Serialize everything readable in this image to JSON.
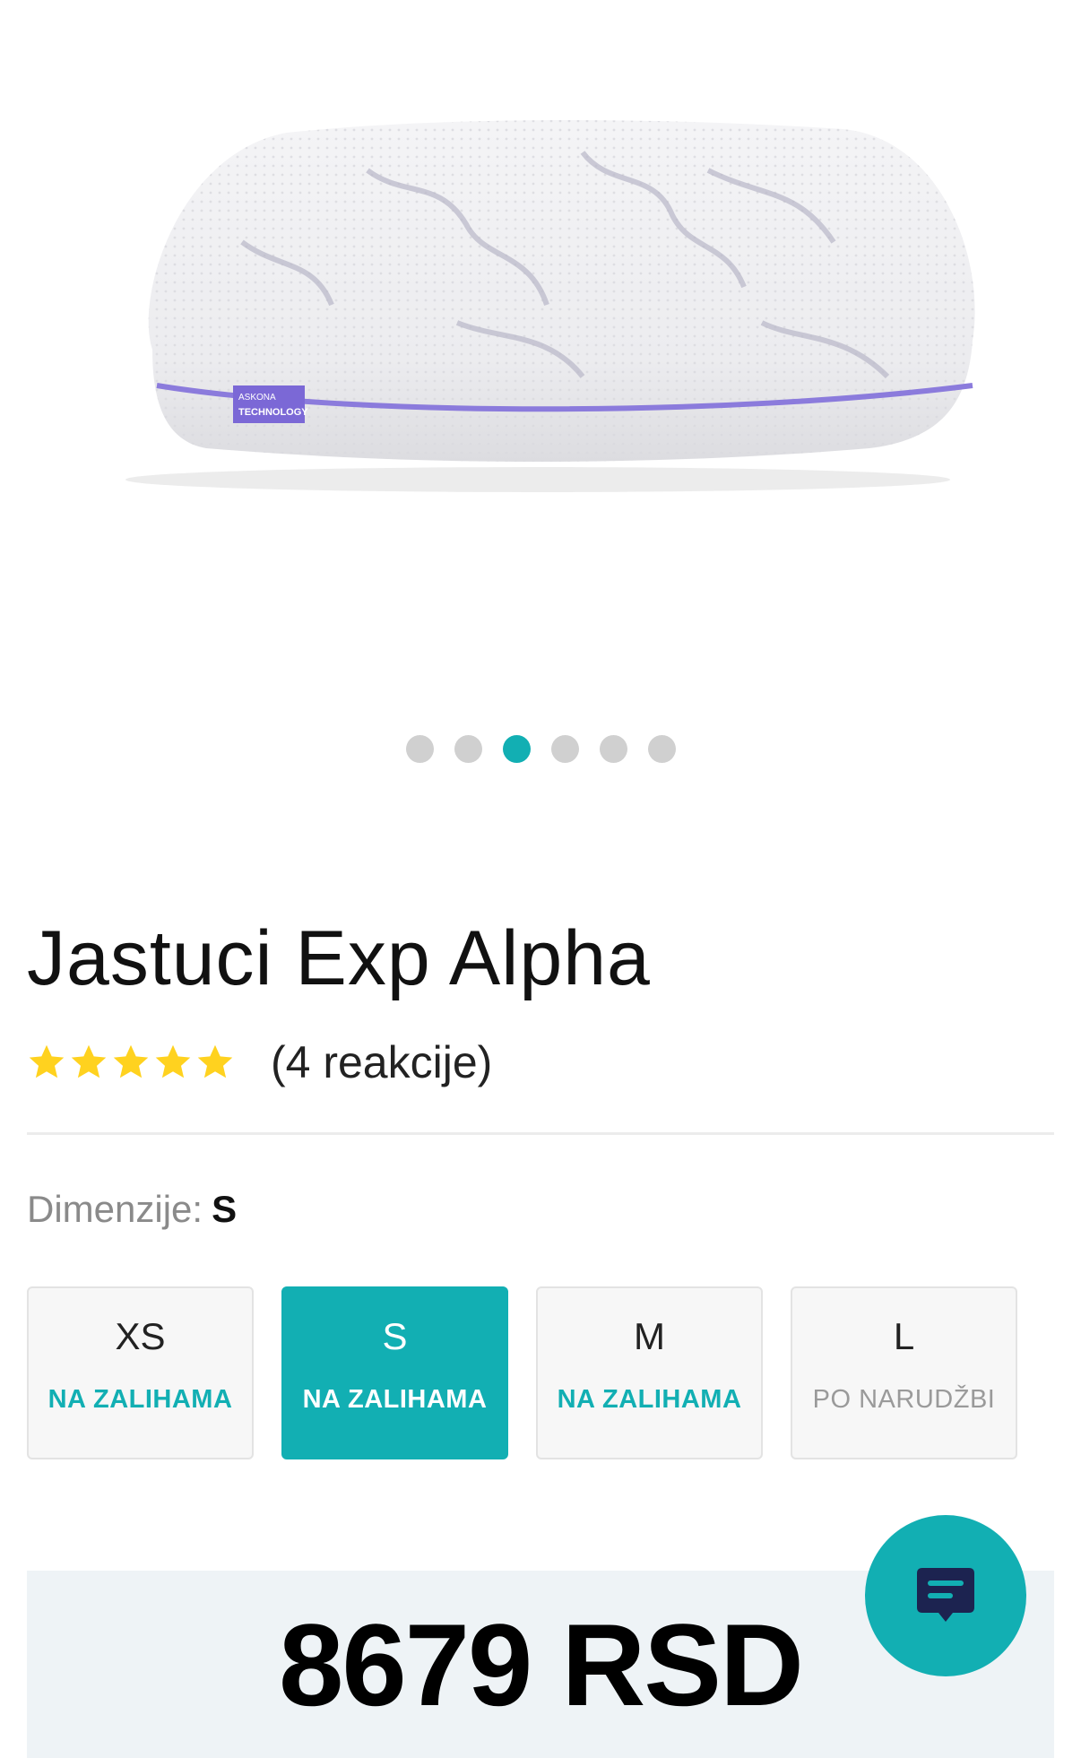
{
  "gallery": {
    "dots_count": 6,
    "active_index": 2,
    "image": {
      "badge_line1": "ASKONA",
      "badge_line2": "TECHNOLOGY",
      "pillow_color": "#f1f1f3",
      "piping_color": "#8b7bdc",
      "badge_color": "#7b68d6"
    }
  },
  "product": {
    "title": "Jastuci Exp Alpha",
    "rating": 5,
    "reviews": "(4 reakcije)"
  },
  "dimensions": {
    "label": "Dimenzije:",
    "selected": "S",
    "options": [
      {
        "size": "XS",
        "status": "NA ZALIHAMA"
      },
      {
        "size": "S",
        "status": "NA ZALIHAMA"
      },
      {
        "size": "M",
        "status": "NA ZALIHAMA"
      },
      {
        "size": "L",
        "status": "PO NARUDŽBI"
      }
    ]
  },
  "price": {
    "value": "8679 RSD"
  },
  "colors": {
    "accent": "#12afb3",
    "star": "#ffd21f",
    "chat_icon": "#1c2350"
  },
  "icons": {
    "star": "star-icon",
    "chat": "chat-icon"
  }
}
